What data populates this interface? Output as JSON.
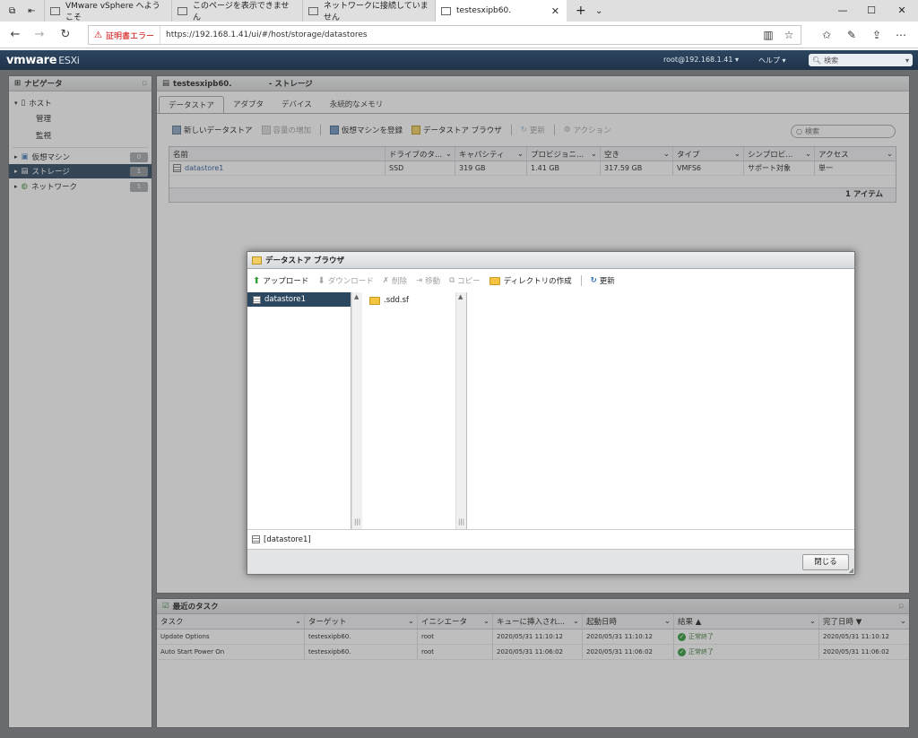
{
  "browser": {
    "tabs": [
      {
        "label": "VMware vSphere へようこそ"
      },
      {
        "label": "このページを表示できません"
      },
      {
        "label": "ネットワークに接続していません"
      },
      {
        "label": "testesxipb60."
      }
    ],
    "cert_error": "証明書エラー",
    "url": "https://192.168.1.41/ui/#/host/storage/datastores"
  },
  "esxi": {
    "logo_main": "vmware",
    "logo_product": "ESXi",
    "user": "root@192.168.1.41 ▾",
    "help": "ヘルプ ▾",
    "search_placeholder": "検索"
  },
  "navigator": {
    "title": "ナビゲータ",
    "items": [
      {
        "label": "ホスト",
        "level": 0
      },
      {
        "label": "管理",
        "level": 1
      },
      {
        "label": "監視",
        "level": 1
      },
      {
        "label": "仮想マシン",
        "level": 0,
        "badge": "0"
      },
      {
        "label": "ストレージ",
        "level": 0,
        "badge": "1",
        "selected": true
      },
      {
        "label": "ネットワーク",
        "level": 0,
        "badge": "1"
      }
    ]
  },
  "main": {
    "title": "testesxipb60.              - ストレージ",
    "tabs": [
      "データストア",
      "アダプタ",
      "デバイス",
      "永続的なメモリ"
    ],
    "toolbar": {
      "new_ds": "新しいデータストア",
      "increase": "容量の増加",
      "register_vm": "仮想マシンを登録",
      "browser": "データストア ブラウザ",
      "refresh": "更新",
      "actions": "アクション",
      "search_placeholder": "検索"
    },
    "columns": [
      "名前",
      "ドライブのタ...",
      "キャパシティ",
      "プロビジョニ...",
      "空き",
      "タイプ",
      "シンプロビ...",
      "アクセス"
    ],
    "rows": [
      [
        "datastore1",
        "SSD",
        "319 GB",
        "1.41 GB",
        "317.59 GB",
        "VMFS6",
        "サポート対象",
        "単一"
      ]
    ],
    "item_count": "1 アイテム"
  },
  "tasks": {
    "title": "最近のタスク",
    "columns": [
      "タスク",
      "ターゲット",
      "イニシエータ",
      "キューに挿入され...",
      "起動日時",
      "結果 ▲",
      "完了日時 ▼"
    ],
    "rows": [
      [
        "Update Options",
        "testesxipb60.",
        "root",
        "2020/05/31 11:10:12",
        "2020/05/31 11:10:12",
        "正常終了",
        "2020/05/31 11:10:12"
      ],
      [
        "Auto Start Power On",
        "testesxipb60.",
        "root",
        "2020/05/31 11:06:02",
        "2020/05/31 11:06:02",
        "正常終了",
        "2020/05/31 11:06:02"
      ]
    ]
  },
  "modal": {
    "title": "データストア ブラウザ",
    "toolbar": {
      "upload": "アップロード",
      "download": "ダウンロード",
      "delete": "削除",
      "move": "移動",
      "copy": "コピー",
      "mkdir": "ディレクトリの作成",
      "refresh": "更新"
    },
    "datastores": [
      "datastore1"
    ],
    "folders": [
      ".sdd.sf"
    ],
    "path": "[datastore1]",
    "close": "閉じる"
  }
}
